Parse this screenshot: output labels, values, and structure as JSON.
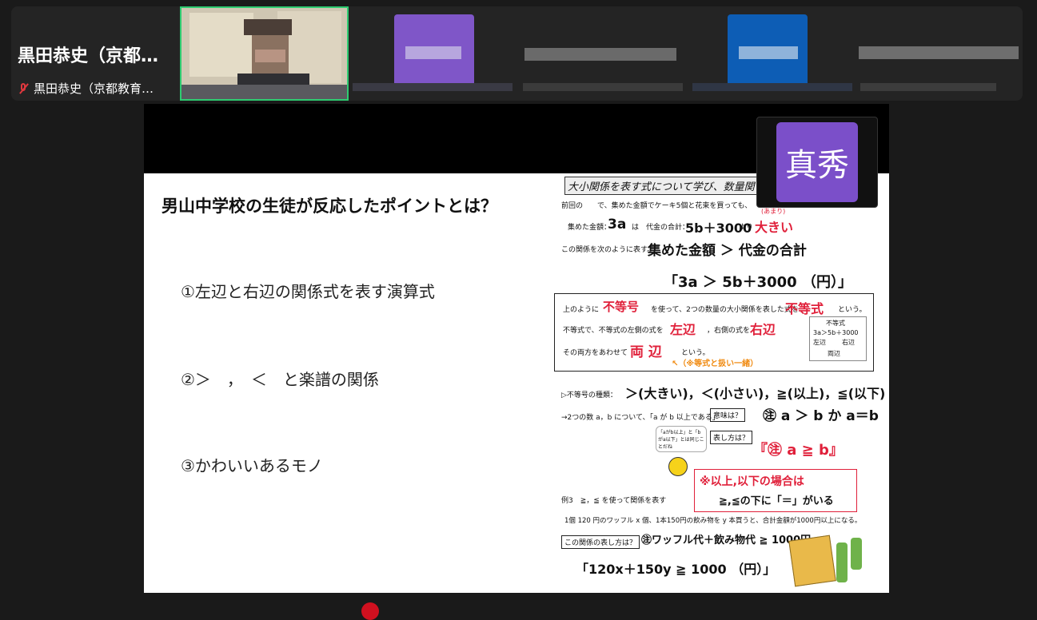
{
  "participants": {
    "first": {
      "display_name": "黒田恭史（京都…",
      "sub_name": "黒田恭史（京都教育…"
    },
    "active_speaker_border": "#2ecc71"
  },
  "slide": {
    "title": "男山中学校の生徒が反応したポイントとは？",
    "points": [
      "①左辺と右辺の関係式を表す演算式",
      "②＞　，　＜　と楽譜の関係",
      "③かわいいあるモノ"
    ]
  },
  "worksheet": {
    "header": "大小関係を表す式について学び、数量関",
    "line1": "前回の　　で、集めた金額でケーキ5個と花束を買っても、",
    "collected_label": "集めた金額：",
    "collected_val": "3a",
    "is_label": "は",
    "total_label": "代金の合計：",
    "total_val": "5b＋3000",
    "yori": "より",
    "bigger": "大きい",
    "bigger_ruby": "(あまり)",
    "rel_line": "この関係を次のように表す。",
    "rel_hand": "集めた金額 ＞ 代金の合計",
    "rel_formula": "「3a ＞ 5b＋3000 （円）」",
    "box": {
      "l1a": "上のように",
      "l1b": "不等号",
      "l1c": "を使って、2つの数量の大小関係を表した式を",
      "l1d": "不等式",
      "l1e": "という。",
      "l2a": "不等式で、不等式の左側の式を",
      "l2b": "左辺",
      "l2c": "，右側の式を",
      "l2d": "右辺",
      "l3a": "その両方をあわせて",
      "l3b": "両 辺",
      "l3c": "という。",
      "l3d": "↖（※等式と扱い一緒）",
      "mini_title": "不等式",
      "mini_formula": "3a＞5b＋3000",
      "mini_left": "左辺",
      "mini_right": "右辺",
      "mini_both": "両辺"
    },
    "types_label": "▷不等号の種類：",
    "types_hand": "＞(大きい)，＜(小さい)，≧(以上)，≦(以下)",
    "line_ab": "→2つの数 a，b について、「a が b 以上である」",
    "meaning_btn": "意味は？",
    "meaning_hand": "㊟ a ＞ b か a＝b",
    "how_btn": "表し方は？",
    "how_hand": "『㊟ a ≧ b』",
    "bubble": "「aがb以上」と「bがa以下」とは同じことだね",
    "note_hand_1": "※以上,以下の場合は",
    "note_hand_2": "≧,≦の下に「＝」がいる",
    "example": "例3　≧，≦ を使って関係を表す",
    "example_text": "1個 120 円のワッフル x 個、1本150円の飲み物を y 本買うと、合計金額が1000円以上になる。",
    "how_rel_btn": "この関係の表し方は？",
    "how_rel_hand": "㊟ワッフル代＋飲み物代 ≧ 1000円",
    "answer_hand": "「120x＋150y ≧ 1000 （円）」"
  },
  "badge": {
    "text": "真秀",
    "color": "#7b4fc9"
  }
}
